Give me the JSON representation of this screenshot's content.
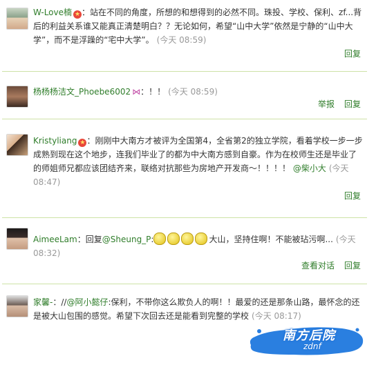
{
  "comments": [
    {
      "username": "W-Love楠",
      "text": "：站在不同的角度，所想的和想得到的必然不同。珠投、学校、保利、zf...背后的利益关系谁又能真正清楚明白？？无论如何，希望“山中大学”依然是宁静的“山中大学”，而不是浮躁的“宅中大学”。",
      "time": "(今天 08:59)",
      "actions": [
        "回复"
      ]
    },
    {
      "username": "杨杨杨洁文_Phoebe6002",
      "text": "：！！",
      "time": "(今天 08:59)",
      "actions": [
        "举报",
        "回复"
      ]
    },
    {
      "username": "Kristyliang",
      "text": "：刚刚中大南方才被评为全国第4，全省第2的独立学院，看着学校一步一步成熟到现在这个地步，连我们毕业了的都为中大南方感到自豪。作为在校师生还是毕业了的师姐师兄都应该团结齐来，联络对抗那些为房地产开发商～！！！！",
      "mention": "@柴小大",
      "time": "(今天 08:47)",
      "actions": [
        "回复"
      ]
    },
    {
      "username": "AimeeLam",
      "prefix": "：回复",
      "mention": "@Sheung_P",
      "text": "大山，坚持住啊！不能被玷污啊...",
      "time": "(今天 08:32)",
      "actions": [
        "查看对话",
        "回复"
      ]
    },
    {
      "username": "家馨-",
      "prefix": "：//",
      "mention": "@阿小懿仔",
      "text": ":保利，不带你这么欺负人的啊！！最爱的还是那条山路，最怀念的还是被大山包围的感觉。希望下次回去还是能看到完整的学校",
      "time": "(今天 08:17)"
    }
  ],
  "watermark": {
    "cn": "南方后院",
    "en": "zdnf"
  }
}
